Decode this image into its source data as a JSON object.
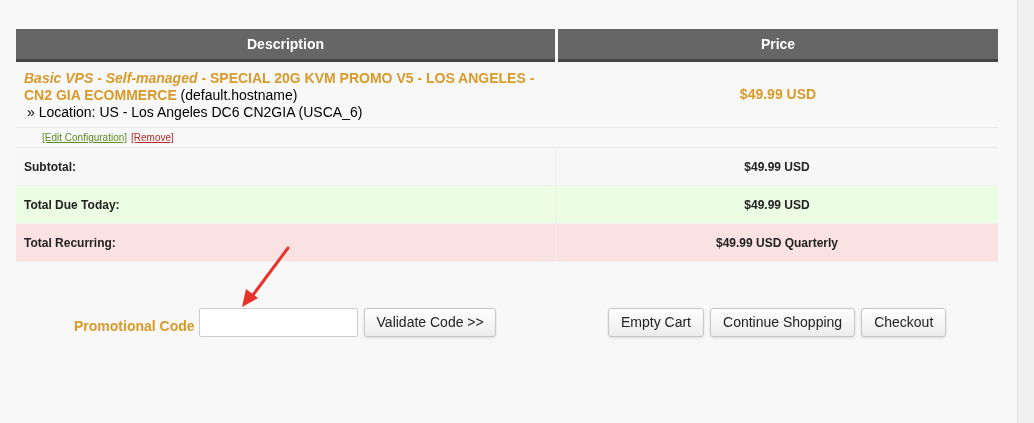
{
  "table": {
    "columns": [
      "Description",
      "Price"
    ],
    "item": {
      "product": "*Basic VPS - Self-managed* - SPECIAL 20G KVM PROMO V5 - LOS ANGELES - CN2 GIA ECOMMERCE",
      "hostname": "(default.hostname)",
      "option": "» Location: US - Los Angeles DC6 CN2GIA (USCA_6)",
      "price": "$49.99 USD",
      "links": [
        {
          "kind": "edit",
          "label": "[Edit Configuration]"
        },
        {
          "kind": "remove",
          "label": "[Remove]"
        }
      ]
    },
    "totals": [
      {
        "kind": "subtotal",
        "label": "Subtotal:",
        "value": "$49.99 USD"
      },
      {
        "kind": "due",
        "label": "Total Due Today:",
        "value": "$49.99 USD"
      },
      {
        "kind": "recurring",
        "label": "Total Recurring:",
        "value": "$49.99 USD Quarterly"
      }
    ]
  },
  "promo": {
    "label": "Promotional Code",
    "button": "Validate Code >>"
  },
  "actions": [
    "Empty Cart",
    "Continue Shopping",
    "Checkout"
  ]
}
